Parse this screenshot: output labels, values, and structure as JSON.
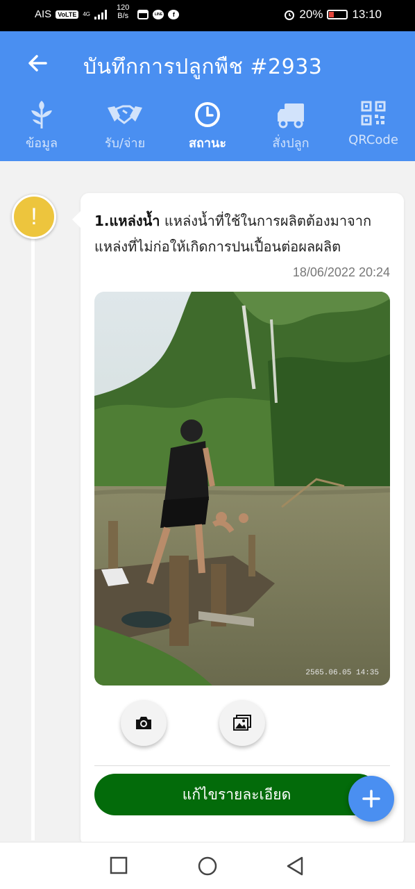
{
  "status_bar": {
    "carrier": "AIS",
    "volte": "VoLTE",
    "network": "4G",
    "speed_value": "120",
    "speed_unit": "B/s",
    "line_label": "LINE",
    "facebook_label": "f",
    "battery": "20%",
    "time": "13:10"
  },
  "header": {
    "title": "บันทึกการปลูกพืช #2933"
  },
  "tabs": [
    {
      "label": "ข้อมูล",
      "icon": "sprout-icon",
      "active": false
    },
    {
      "label": "รับ/จ่าย",
      "icon": "handshake-icon",
      "active": false
    },
    {
      "label": "สถานะ",
      "icon": "clock-icon",
      "active": true
    },
    {
      "label": "สั่งปลูก",
      "icon": "truck-icon",
      "active": false
    },
    {
      "label": "QRCode",
      "icon": "qrcode-icon",
      "active": false
    }
  ],
  "timeline": {
    "status_marker": "!",
    "entry": {
      "topic": "1.แหล่งน้ำ",
      "description": " แหล่งน้ำที่ใช้ในการผลิตต้องมาจากแหล่งที่ไม่ก่อให้เกิดการปนเปื้อนต่อผลผลิต",
      "date": "18/06/2022 20:24",
      "photo_stamp": "2565.06.05 14:35",
      "camera_icon": "camera-icon",
      "gallery_icon": "gallery-icon",
      "edit_label": "แก้ไขรายละเอียด"
    }
  },
  "fab": {
    "label": "+"
  },
  "colors": {
    "header": "#4a8ff1",
    "status_marker": "#edc53d",
    "edit_button": "#036b0a",
    "fab": "#4a8ff1"
  }
}
